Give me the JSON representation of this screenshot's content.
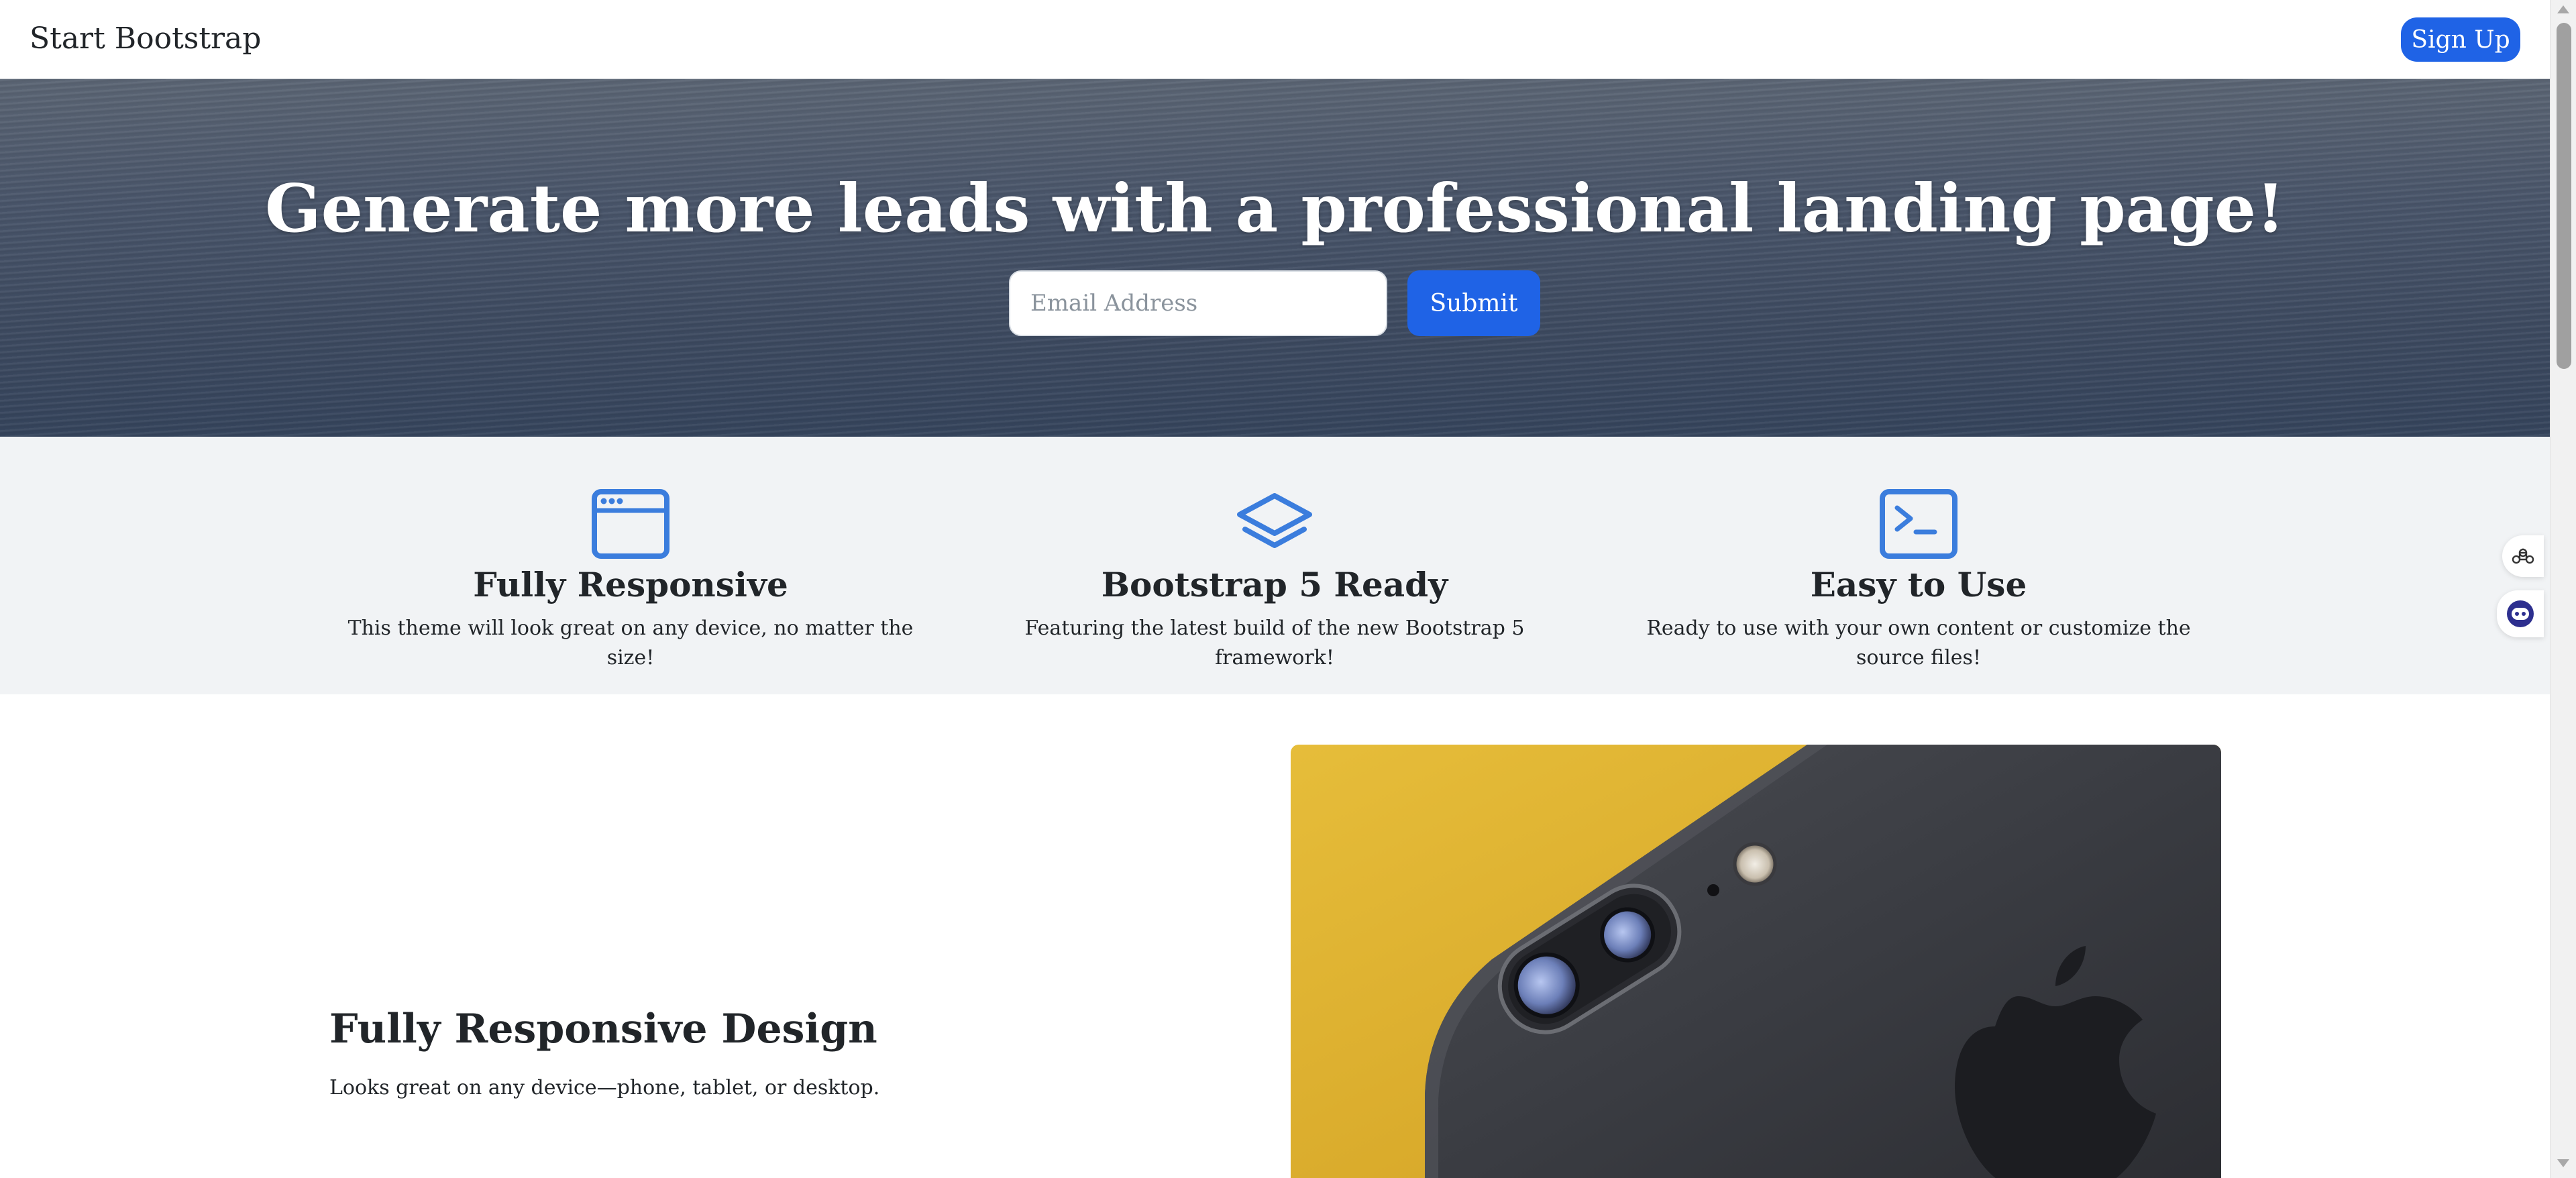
{
  "navbar": {
    "brand": "Start Bootstrap",
    "signup_label": "Sign Up"
  },
  "hero": {
    "title": "Generate more leads with a professional landing page!",
    "email_placeholder": "Email Address",
    "submit_label": "Submit"
  },
  "features": [
    {
      "icon": "browser-window-icon",
      "title": "Fully Responsive",
      "text": "This theme will look great on any device, no matter the size!"
    },
    {
      "icon": "layers-icon",
      "title": "Bootstrap 5 Ready",
      "text": "Featuring the latest build of the new Bootstrap 5 framework!"
    },
    {
      "icon": "terminal-icon",
      "title": "Easy to Use",
      "text": "Ready to use with your own content or customize the source files!"
    }
  ],
  "showcase": {
    "title": "Fully Responsive Design",
    "text": "Looks great on any device—phone, tablet, or desktop.",
    "image": "black-phone-on-yellow-background"
  },
  "side_widgets": [
    "command-key-icon",
    "assistant-robot-icon"
  ],
  "colors": {
    "primary": "#1f63e6",
    "icon_blue": "#3b7ddd",
    "feature_bg": "#f1f3f5",
    "text": "#212529"
  }
}
